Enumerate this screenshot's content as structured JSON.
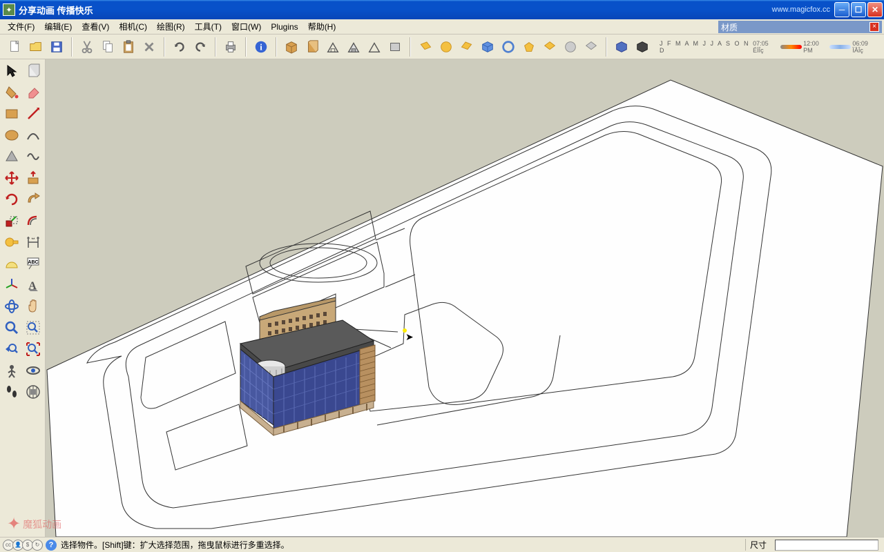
{
  "window": {
    "title": "分享动画  传播快乐",
    "url": "www.magicfox.cc"
  },
  "menu": {
    "items": [
      {
        "label": "文件(F)"
      },
      {
        "label": "编辑(E)"
      },
      {
        "label": "查看(V)"
      },
      {
        "label": "相机(C)"
      },
      {
        "label": "绘图(R)"
      },
      {
        "label": "工具(T)"
      },
      {
        "label": "窗口(W)"
      },
      {
        "label": "Plugins"
      },
      {
        "label": "帮助(H)"
      }
    ],
    "materials_title": "材质"
  },
  "toolbar_top": {
    "icons": [
      "new",
      "open",
      "save",
      "cut",
      "copy",
      "paste",
      "delete",
      "undo",
      "redo",
      "print",
      "info",
      "model",
      "component",
      "house1",
      "house2",
      "house3",
      "box",
      "warehouse1",
      "warehouse2",
      "warehouse3",
      "layer1",
      "layer2",
      "layer3",
      "layer4",
      "shadow1",
      "shadow2"
    ],
    "shadow_months": "J F M A M J J A S O N D",
    "time1": "07:05 ÉÌÎç",
    "time2": "12:00 PM",
    "time3": "06:09 ÏÂÎç"
  },
  "status": {
    "hint": "选择物件。[Shift]键：扩大选择范围，拖曳鼠标进行多重选择。",
    "dim_label": "尺寸"
  },
  "watermark": {
    "text": "魔狐动画"
  }
}
